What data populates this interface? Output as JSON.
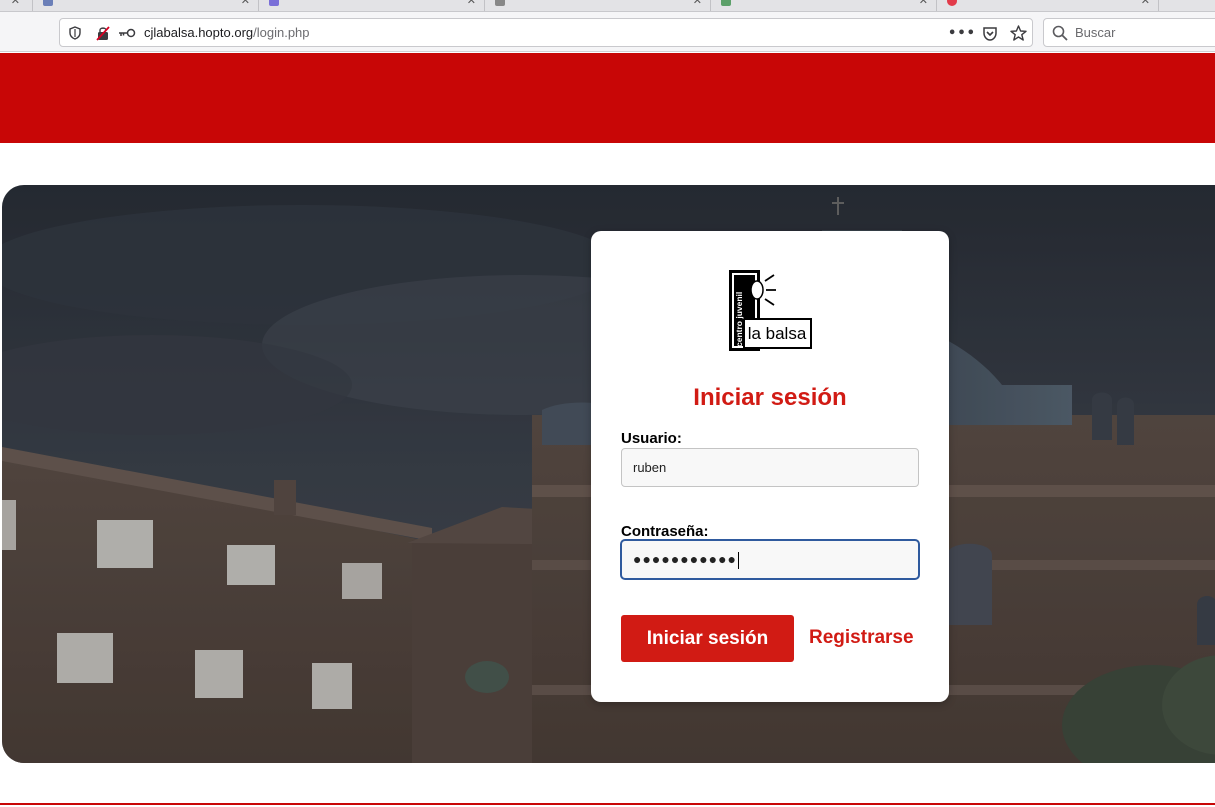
{
  "browser": {
    "url_host": "cjlabalsa.hopto.org",
    "url_path": "/login.php",
    "search_placeholder": "Buscar",
    "menu_icon": "more-dots-icon",
    "pocket_icon": "pocket-icon",
    "bookmark_icon": "star-icon"
  },
  "colors": {
    "brand_red": "#c80606",
    "title_red": "#d11b14",
    "focus_blue": "#2f5a9e"
  },
  "logo": {
    "line1": "centro juvenil",
    "line2": "la balsa"
  },
  "login": {
    "title": "Iniciar sesión",
    "user_label": "Usuario:",
    "user_value": "ruben",
    "password_label": "Contraseña:",
    "password_mask": "●●●●●●●●●●●",
    "submit_label": "Iniciar sesión",
    "register_label": "Registrarse"
  }
}
